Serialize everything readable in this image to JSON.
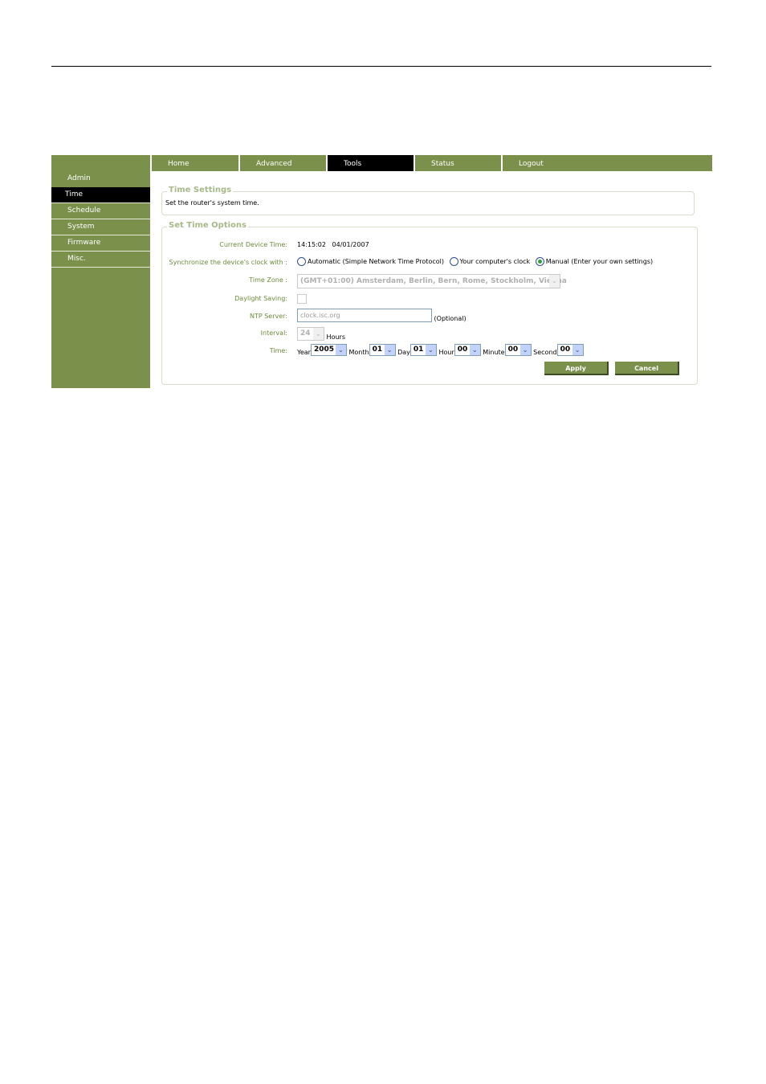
{
  "nav": {
    "tabs": [
      {
        "label": "Home",
        "active": false
      },
      {
        "label": "Advanced",
        "active": false
      },
      {
        "label": "Tools",
        "active": true
      },
      {
        "label": "Status",
        "active": false
      },
      {
        "label": "Logout",
        "active": false
      }
    ]
  },
  "sidebar": {
    "items": [
      {
        "label": "Admin",
        "active": false
      },
      {
        "label": "Time",
        "active": true
      },
      {
        "label": "Schedule",
        "active": false
      },
      {
        "label": "System",
        "active": false
      },
      {
        "label": "Firmware",
        "active": false
      },
      {
        "label": "Misc.",
        "active": false
      }
    ]
  },
  "time_settings": {
    "title": "Time Settings",
    "description": "Set the router's system time."
  },
  "options": {
    "title": "Set Time Options",
    "current_time_label": "Current Device Time:",
    "current_time_value": "14:15:02   04/01/2007",
    "sync_label": "Synchronize the device's clock with :",
    "sync_options": [
      {
        "label": "Automatic (Simple Network Time Protocol)",
        "checked": false
      },
      {
        "label": "Your computer's clock",
        "checked": false
      },
      {
        "label": "Manual (Enter your own settings)",
        "checked": true
      }
    ],
    "timezone_label": "Time Zone :",
    "timezone_value": "(GMT+01:00) Amsterdam, Berlin, Bern, Rome, Stockholm, Vienna",
    "daylight_label": "Daylight Saving:",
    "daylight_checked": false,
    "ntp_label": "NTP Server:",
    "ntp_value": "clock.isc.org",
    "ntp_optional": "(Optional)",
    "interval_label": "Interval:",
    "interval_value": "24",
    "interval_unit": "Hours",
    "time_label": "Time:",
    "time_fields": {
      "year_label": "Year",
      "year": "2005",
      "month_label": "Month",
      "month": "01",
      "day_label": "Day",
      "day": "01",
      "hour_label": "Hour",
      "hour": "00",
      "minute_label": "Minute",
      "minute": "00",
      "second_label": "Second",
      "second": "00"
    },
    "apply_label": "Apply",
    "cancel_label": "Cancel"
  },
  "icons": {
    "dropdown": "chevron-down-icon"
  },
  "colors": {
    "accent": "#7a904b",
    "active": "#000000",
    "legend": "#a7b889",
    "label": "#6b8a3a"
  }
}
